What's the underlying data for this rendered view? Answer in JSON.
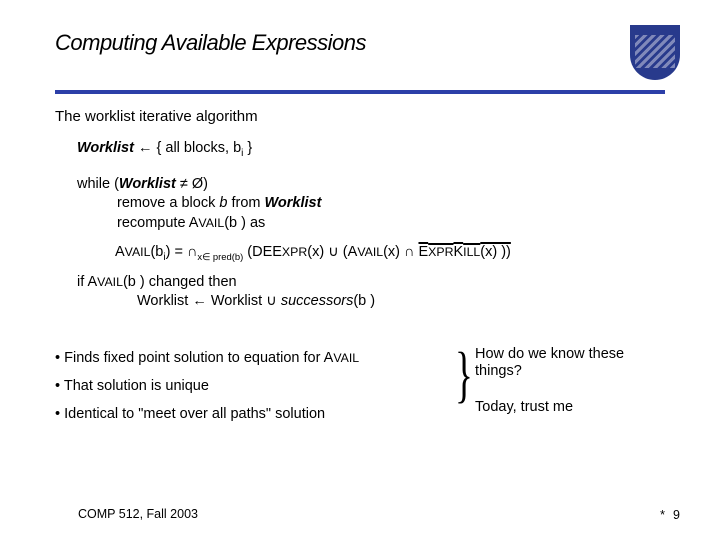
{
  "title": "Computing Available Expressions",
  "subtitle": "The worklist iterative algorithm",
  "algo": {
    "line1_pre": "Worklist",
    "line1_arrow": " ← ",
    "line1_post": "{ all blocks, b",
    "line1_sub": "i",
    "line1_close": " }",
    "while_pre": "while (",
    "while_var": "Worklist",
    "while_post": " ≠ Ø)",
    "remove_pre": "remove a block ",
    "remove_b": "b",
    "remove_post": " from ",
    "remove_wl": "Worklist",
    "recompute_pre": "recompute A",
    "recompute_sc": "VAIL",
    "recompute_post": "(b ) as",
    "formula_lhs_pre": "A",
    "formula_lhs_sc": "VAIL",
    "formula_lhs_post": "(b",
    "formula_lhs_sub": "i",
    "formula_lhs_close": ")  =  ",
    "formula_cap": "∩",
    "formula_cap_sub": "x∈ pred(b)",
    "formula_deexpr_pre": " (DEE",
    "formula_deexpr_sc": "XPR",
    "formula_deexpr_post": "(x) ∪ (A",
    "formula_avail_sc": "VAIL",
    "formula_avail_post": "(x) ∩ ",
    "formula_exprkill_pre": "E",
    "formula_exprkill_sc1": "XPR",
    "formula_exprkill_mid": "K",
    "formula_exprkill_sc2": "ILL",
    "formula_exprkill_post": "(x) ))",
    "if_pre": "if A",
    "if_sc": "VAIL",
    "if_post": "(b ) changed then",
    "then_pre": "Worklist ← Worklist ∪ ",
    "then_succ": "successors",
    "then_post": "(b )"
  },
  "bullets": {
    "b1_pre": "Finds fixed point solution to equation for A",
    "b1_sc": "VAIL",
    "b2": "That solution is unique",
    "b3": "Identical to \"meet over all paths\" solution"
  },
  "right": {
    "q": "How do we know these things?",
    "a": "Today, trust me"
  },
  "footer": {
    "left": "COMP 512, Fall 2003",
    "asterisk": "*",
    "page": "9"
  }
}
